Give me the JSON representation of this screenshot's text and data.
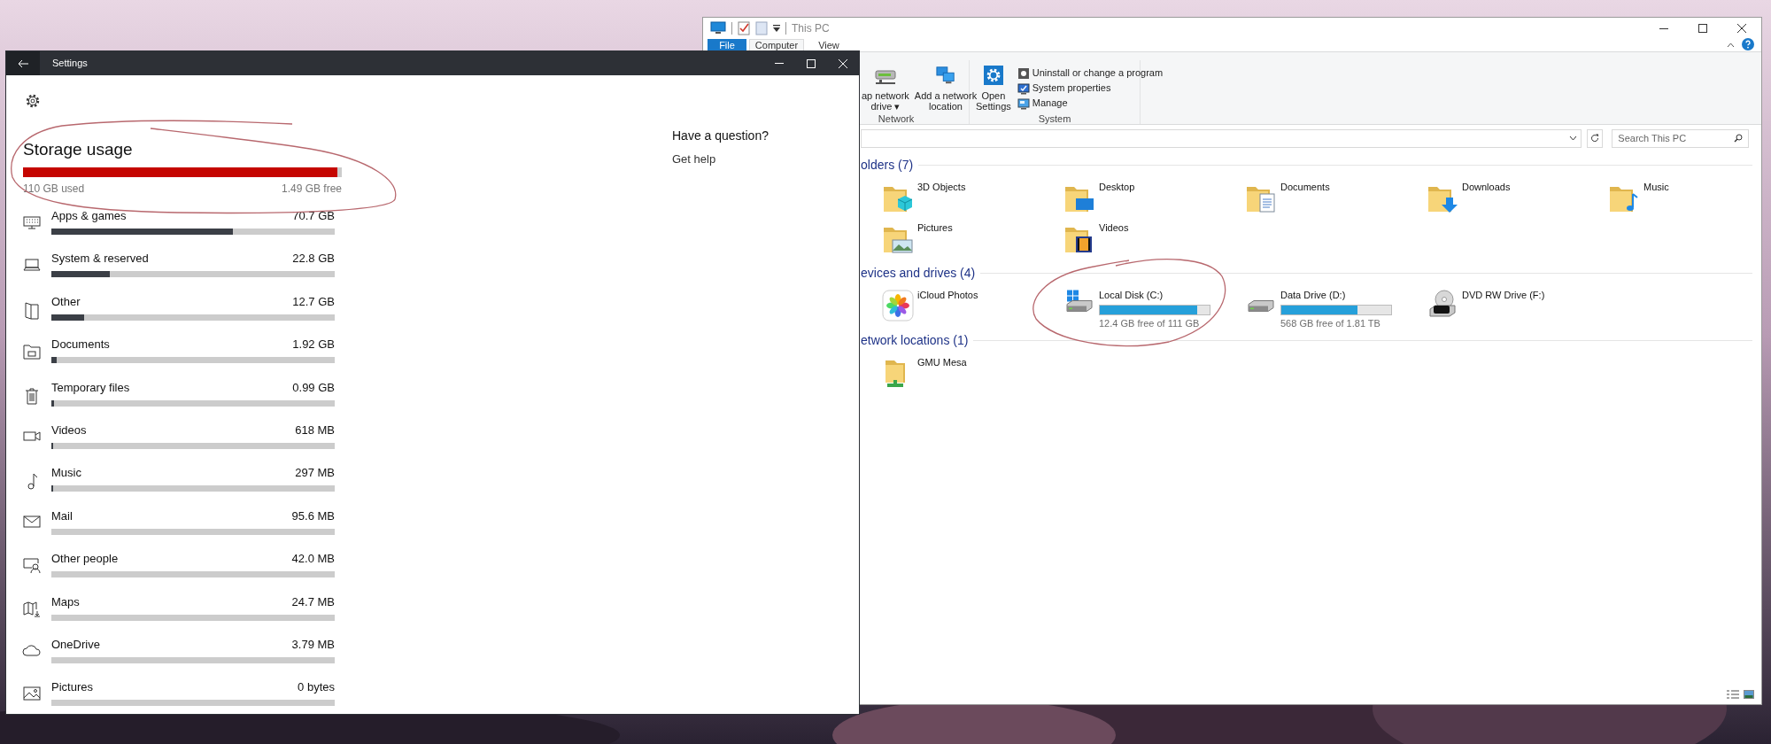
{
  "explorer": {
    "title": "This PC",
    "tabs": [
      {
        "label": "File",
        "selected": false,
        "kind": "file"
      },
      {
        "label": "Computer",
        "selected": true,
        "kind": "tab"
      },
      {
        "label": "View",
        "selected": false,
        "kind": "tab"
      }
    ],
    "ribbon": [
      {
        "label": "Network",
        "items": [
          {
            "kind": "large",
            "lines": [
              "ap network",
              "drive ▾"
            ]
          },
          {
            "kind": "large",
            "lines": [
              "Add a network",
              "location"
            ]
          }
        ]
      },
      {
        "label": "System",
        "items": [
          {
            "kind": "large",
            "lines": [
              "Open",
              "Settings"
            ]
          },
          {
            "kind": "small",
            "lines": [
              "Uninstall or change a program"
            ]
          },
          {
            "kind": "small",
            "lines": [
              "System properties"
            ]
          },
          {
            "kind": "small",
            "lines": [
              "Manage"
            ]
          }
        ]
      }
    ],
    "search": {
      "placeholder": "Search This PC"
    },
    "sections": [
      {
        "header": "olders (7)",
        "items": [
          {
            "kind": "folder",
            "label": "3D Objects"
          },
          {
            "kind": "folder",
            "label": "Desktop"
          },
          {
            "kind": "folder",
            "label": "Documents"
          },
          {
            "kind": "folder",
            "label": "Downloads"
          },
          {
            "kind": "folder",
            "label": "Music"
          },
          {
            "kind": "folder",
            "label": "Pictures"
          },
          {
            "kind": "folder",
            "label": "Videos"
          }
        ]
      },
      {
        "header": "evices and drives (4)",
        "items": [
          {
            "kind": "app",
            "label": "iCloud Photos"
          },
          {
            "kind": "system_drive",
            "label": "Local Disk (C:)",
            "level": 0.89,
            "free": "12.4 GB free of 111 GB"
          },
          {
            "kind": "drive",
            "label": "Data Drive (D:)",
            "level": 0.69,
            "free": "568 GB free of 1.81 TB"
          },
          {
            "kind": "dvd",
            "label": "DVD RW Drive (F:)"
          }
        ]
      },
      {
        "header": "etwork locations (1)",
        "items": [
          {
            "kind": "network",
            "label": "GMU Mesa"
          }
        ]
      }
    ]
  },
  "settings": {
    "title": "Settings",
    "heading": "Storage usage",
    "usage": {
      "level": 0.987,
      "used": "110 GB used",
      "free": "1.49 GB free"
    },
    "categories": [
      {
        "name": "Apps & games",
        "size": "70.7 GB",
        "level": 0.64
      },
      {
        "name": "System & reserved",
        "size": "22.8 GB",
        "level": 0.205
      },
      {
        "name": "Other",
        "size": "12.7 GB",
        "level": 0.116
      },
      {
        "name": "Documents",
        "size": "1.92 GB",
        "level": 0.018
      },
      {
        "name": "Temporary files",
        "size": "0.99 GB",
        "level": 0.009
      },
      {
        "name": "Videos",
        "size": "618 MB",
        "level": 0.005
      },
      {
        "name": "Music",
        "size": "297 MB",
        "level": 0.003
      },
      {
        "name": "Mail",
        "size": "95.6 MB"
      },
      {
        "name": "Other people",
        "size": "42.0 MB"
      },
      {
        "name": "Maps",
        "size": "24.7 MB"
      },
      {
        "name": "OneDrive",
        "size": "3.79 MB"
      },
      {
        "name": "Pictures",
        "size": "0 bytes"
      }
    ],
    "help": {
      "question": "Have a question?",
      "link": "Get help"
    }
  }
}
